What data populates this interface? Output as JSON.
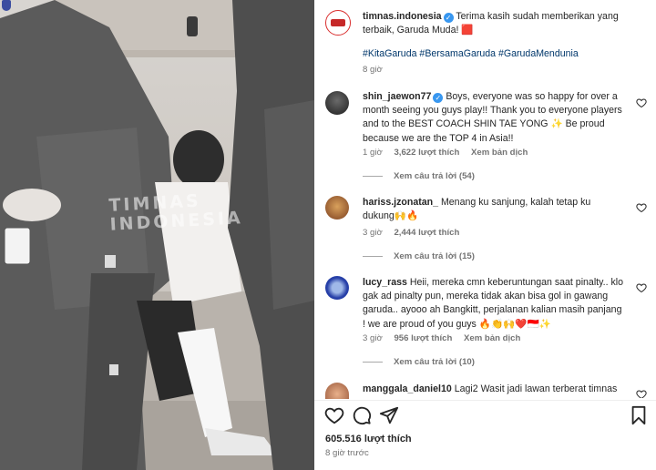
{
  "post": {
    "username": "timnas.indonesia",
    "caption_line1": "Terima kasih sudah memberikan yang",
    "caption_line2": "terbaik, Garuda Muda! 🟥",
    "hashtags": "#KitaGaruda #BersamaGaruda #GarudaMendunia",
    "time": "8 giờ",
    "likes": "605.516 lượt thích",
    "posted_ago": "8 giờ trước"
  },
  "photo": {
    "watermark_line1": "TIMNAS",
    "watermark_line2": "INDONESIA"
  },
  "comments": [
    {
      "username": "shin_jaewon77",
      "verified": true,
      "lines": [
        "Boys, everyone was so happy for over a",
        "month seeing you guys play!! Thank you to everyone players",
        "and to the BEST COACH SHIN TAE YONG ✨ Be proud",
        "because we are the TOP 4 in Asia!!"
      ],
      "time": "1 giờ",
      "likes": "3,622 lượt thích",
      "translate": "Xem bản dịch",
      "replies": "Xem câu trả lời (54)"
    },
    {
      "username": "hariss.jzonatan_",
      "lines": [
        "Menang ku sanjung, kalah tetap ku",
        "dukung🙌🔥"
      ],
      "time": "3 giờ",
      "likes": "2,444 lượt thích",
      "replies": "Xem câu trả lời (15)"
    },
    {
      "username": "lucy_rass",
      "lines": [
        "Heii, mereka cmn keberuntungan saat pinalty.. klo",
        "gak ad pinalty pun, mereka tidak akan bisa gol in gawang",
        "garuda.. ayooo ah Bangkitt, perjalanan kalian masih panjang",
        "! we are proud of you guys 🔥👏🙌❤️🇮🇩✨"
      ],
      "time": "3 giờ",
      "likes": "956 lượt thích",
      "translate": "Xem bản dịch",
      "replies": "Xem câu trả lời (10)"
    },
    {
      "username": "manggala_daniel10",
      "lines": [
        "Lagi2 Wasit jadi lawan terberat timnas"
      ]
    }
  ],
  "colors": {
    "accent_blue": "#3897f0",
    "hashtag": "#00376b",
    "muted": "#737373"
  },
  "icons": [
    "heart-icon",
    "comment-icon",
    "share-icon",
    "bookmark-icon",
    "verified-icon"
  ]
}
